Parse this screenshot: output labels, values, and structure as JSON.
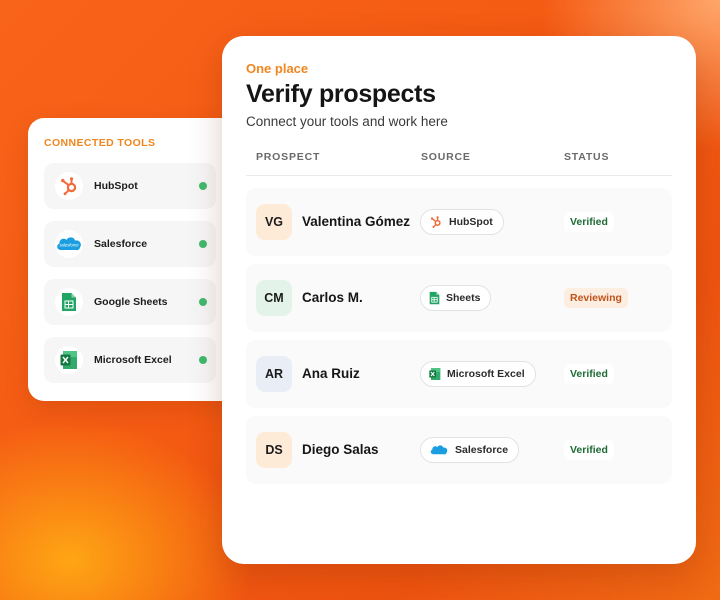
{
  "tools_panel": {
    "title": "CONNECTED TOOLS",
    "items": [
      {
        "label": "HubSpot",
        "icon": "hubspot-icon",
        "status_color": "#3fba6d"
      },
      {
        "label": "Salesforce",
        "icon": "salesforce-icon",
        "status_color": "#3fba6d"
      },
      {
        "label": "Google Sheets",
        "icon": "google-sheets-icon",
        "status_color": "#3fba6d"
      },
      {
        "label": "Microsoft Excel",
        "icon": "microsoft-excel-icon",
        "status_color": "#3fba6d"
      }
    ]
  },
  "main": {
    "eyebrow": "One place",
    "title": "Verify prospects",
    "subtitle": "Connect your tools and work here",
    "columns": [
      "PROSPECT",
      "SOURCE",
      "STATUS"
    ],
    "rows": [
      {
        "initials": "VG",
        "name": "Valentina Gómez",
        "source": "HubSpot",
        "source_icon": "hubspot-icon",
        "status": "Verified",
        "avatar_color": "#fdebd8"
      },
      {
        "initials": "CM",
        "name": "Carlos M.",
        "source": "Sheets",
        "source_icon": "google-sheets-icon",
        "status": "Reviewing",
        "avatar_color": "#e4f3ea"
      },
      {
        "initials": "AR",
        "name": "Ana Ruiz",
        "source": "Microsoft Excel",
        "source_icon": "microsoft-excel-icon",
        "status": "Verified",
        "avatar_color": "#e9edf5"
      },
      {
        "initials": "DS",
        "name": "Diego Salas",
        "source": "Salesforce",
        "source_icon": "salesforce-icon",
        "status": "Verified",
        "avatar_color": "#fdebd8"
      }
    ]
  },
  "colors": {
    "accent": "#f0861e",
    "verified_text": "#1e6b34",
    "verified_bg": "#ffffff",
    "reviewing_text": "#c0531a",
    "reviewing_bg": "#fdeee2",
    "online_dot": "#3fba6d"
  }
}
